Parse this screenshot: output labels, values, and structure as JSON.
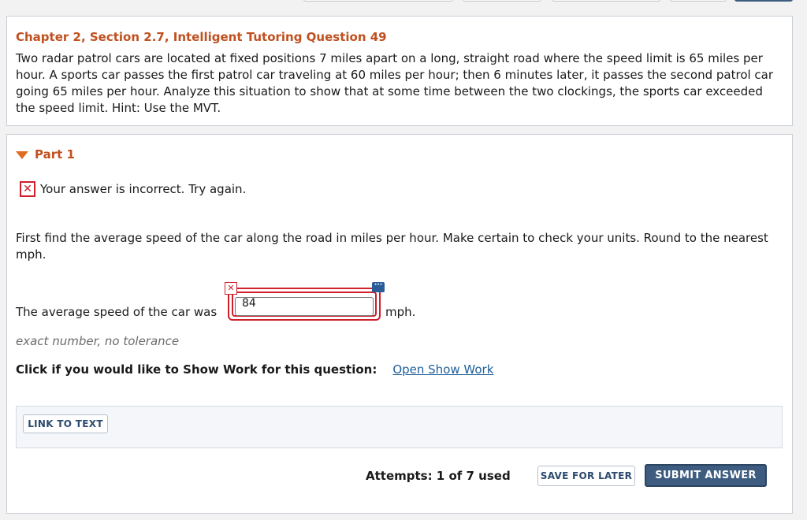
{
  "question": {
    "title": "Chapter 2, Section 2.7, Intelligent Tutoring Question 49",
    "text": "Two radar patrol cars are located at fixed positions 7 miles apart on a long, straight road where the speed limit is 65 miles per hour. A sports car passes the first patrol car traveling at 60 miles per hour; then 6 minutes later, it passes the second patrol car going 65 miles per hour. Analyze this situation to show that at some time between the two clockings, the sports car exceeded the speed limit. Hint: Use the MVT."
  },
  "part": {
    "label": "Part 1",
    "feedback": "Your answer is incorrect.  Try again.",
    "feedback_icon": "x-error-icon",
    "instruction": "First find the average speed of the car along the road in miles per hour. Make certain to check your units. Round to the nearest mph.",
    "answer": {
      "prefix": "The average speed of the car was",
      "value": "84",
      "unit": "mph."
    },
    "tolerance": "exact number, no tolerance",
    "show_work_label": "Click if you would like to Show Work for this question:",
    "show_work_link": "Open Show Work",
    "link_to_text": "LINK TO TEXT",
    "attempts": "Attempts: 1 of 7 used",
    "save_later": "SAVE FOR LATER",
    "submit": "SUBMIT ANSWER"
  },
  "colors": {
    "accent_orange": "#c0501f",
    "error_red": "#d0202a",
    "link_blue": "#1f5f9a",
    "submit_blue": "#3d5c80"
  }
}
